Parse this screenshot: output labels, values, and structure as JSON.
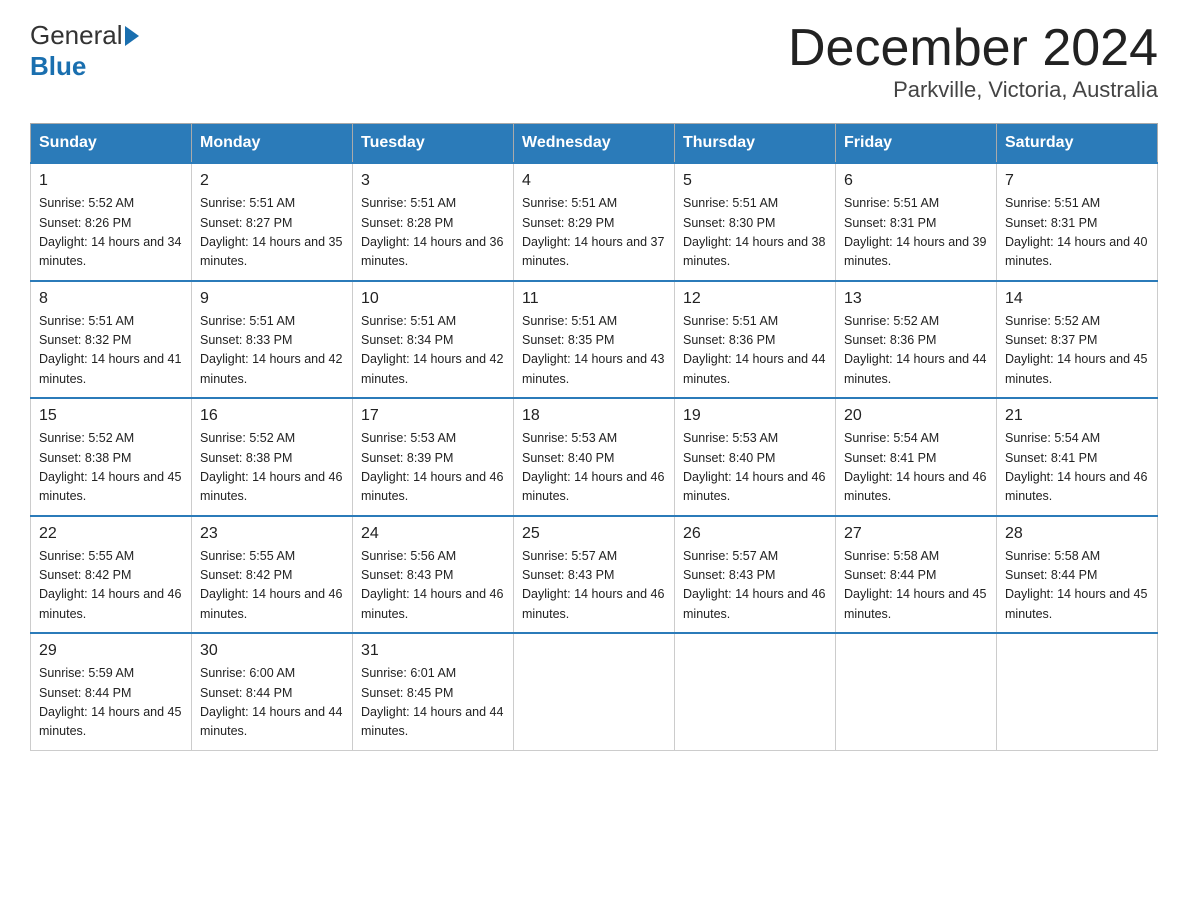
{
  "header": {
    "logo_general": "General",
    "logo_blue": "Blue",
    "title": "December 2024",
    "subtitle": "Parkville, Victoria, Australia"
  },
  "weekdays": [
    "Sunday",
    "Monday",
    "Tuesday",
    "Wednesday",
    "Thursday",
    "Friday",
    "Saturday"
  ],
  "weeks": [
    [
      {
        "day": "1",
        "sunrise": "5:52 AM",
        "sunset": "8:26 PM",
        "daylight": "14 hours and 34 minutes."
      },
      {
        "day": "2",
        "sunrise": "5:51 AM",
        "sunset": "8:27 PM",
        "daylight": "14 hours and 35 minutes."
      },
      {
        "day": "3",
        "sunrise": "5:51 AM",
        "sunset": "8:28 PM",
        "daylight": "14 hours and 36 minutes."
      },
      {
        "day": "4",
        "sunrise": "5:51 AM",
        "sunset": "8:29 PM",
        "daylight": "14 hours and 37 minutes."
      },
      {
        "day": "5",
        "sunrise": "5:51 AM",
        "sunset": "8:30 PM",
        "daylight": "14 hours and 38 minutes."
      },
      {
        "day": "6",
        "sunrise": "5:51 AM",
        "sunset": "8:31 PM",
        "daylight": "14 hours and 39 minutes."
      },
      {
        "day": "7",
        "sunrise": "5:51 AM",
        "sunset": "8:31 PM",
        "daylight": "14 hours and 40 minutes."
      }
    ],
    [
      {
        "day": "8",
        "sunrise": "5:51 AM",
        "sunset": "8:32 PM",
        "daylight": "14 hours and 41 minutes."
      },
      {
        "day": "9",
        "sunrise": "5:51 AM",
        "sunset": "8:33 PM",
        "daylight": "14 hours and 42 minutes."
      },
      {
        "day": "10",
        "sunrise": "5:51 AM",
        "sunset": "8:34 PM",
        "daylight": "14 hours and 42 minutes."
      },
      {
        "day": "11",
        "sunrise": "5:51 AM",
        "sunset": "8:35 PM",
        "daylight": "14 hours and 43 minutes."
      },
      {
        "day": "12",
        "sunrise": "5:51 AM",
        "sunset": "8:36 PM",
        "daylight": "14 hours and 44 minutes."
      },
      {
        "day": "13",
        "sunrise": "5:52 AM",
        "sunset": "8:36 PM",
        "daylight": "14 hours and 44 minutes."
      },
      {
        "day": "14",
        "sunrise": "5:52 AM",
        "sunset": "8:37 PM",
        "daylight": "14 hours and 45 minutes."
      }
    ],
    [
      {
        "day": "15",
        "sunrise": "5:52 AM",
        "sunset": "8:38 PM",
        "daylight": "14 hours and 45 minutes."
      },
      {
        "day": "16",
        "sunrise": "5:52 AM",
        "sunset": "8:38 PM",
        "daylight": "14 hours and 46 minutes."
      },
      {
        "day": "17",
        "sunrise": "5:53 AM",
        "sunset": "8:39 PM",
        "daylight": "14 hours and 46 minutes."
      },
      {
        "day": "18",
        "sunrise": "5:53 AM",
        "sunset": "8:40 PM",
        "daylight": "14 hours and 46 minutes."
      },
      {
        "day": "19",
        "sunrise": "5:53 AM",
        "sunset": "8:40 PM",
        "daylight": "14 hours and 46 minutes."
      },
      {
        "day": "20",
        "sunrise": "5:54 AM",
        "sunset": "8:41 PM",
        "daylight": "14 hours and 46 minutes."
      },
      {
        "day": "21",
        "sunrise": "5:54 AM",
        "sunset": "8:41 PM",
        "daylight": "14 hours and 46 minutes."
      }
    ],
    [
      {
        "day": "22",
        "sunrise": "5:55 AM",
        "sunset": "8:42 PM",
        "daylight": "14 hours and 46 minutes."
      },
      {
        "day": "23",
        "sunrise": "5:55 AM",
        "sunset": "8:42 PM",
        "daylight": "14 hours and 46 minutes."
      },
      {
        "day": "24",
        "sunrise": "5:56 AM",
        "sunset": "8:43 PM",
        "daylight": "14 hours and 46 minutes."
      },
      {
        "day": "25",
        "sunrise": "5:57 AM",
        "sunset": "8:43 PM",
        "daylight": "14 hours and 46 minutes."
      },
      {
        "day": "26",
        "sunrise": "5:57 AM",
        "sunset": "8:43 PM",
        "daylight": "14 hours and 46 minutes."
      },
      {
        "day": "27",
        "sunrise": "5:58 AM",
        "sunset": "8:44 PM",
        "daylight": "14 hours and 45 minutes."
      },
      {
        "day": "28",
        "sunrise": "5:58 AM",
        "sunset": "8:44 PM",
        "daylight": "14 hours and 45 minutes."
      }
    ],
    [
      {
        "day": "29",
        "sunrise": "5:59 AM",
        "sunset": "8:44 PM",
        "daylight": "14 hours and 45 minutes."
      },
      {
        "day": "30",
        "sunrise": "6:00 AM",
        "sunset": "8:44 PM",
        "daylight": "14 hours and 44 minutes."
      },
      {
        "day": "31",
        "sunrise": "6:01 AM",
        "sunset": "8:45 PM",
        "daylight": "14 hours and 44 minutes."
      },
      null,
      null,
      null,
      null
    ]
  ]
}
